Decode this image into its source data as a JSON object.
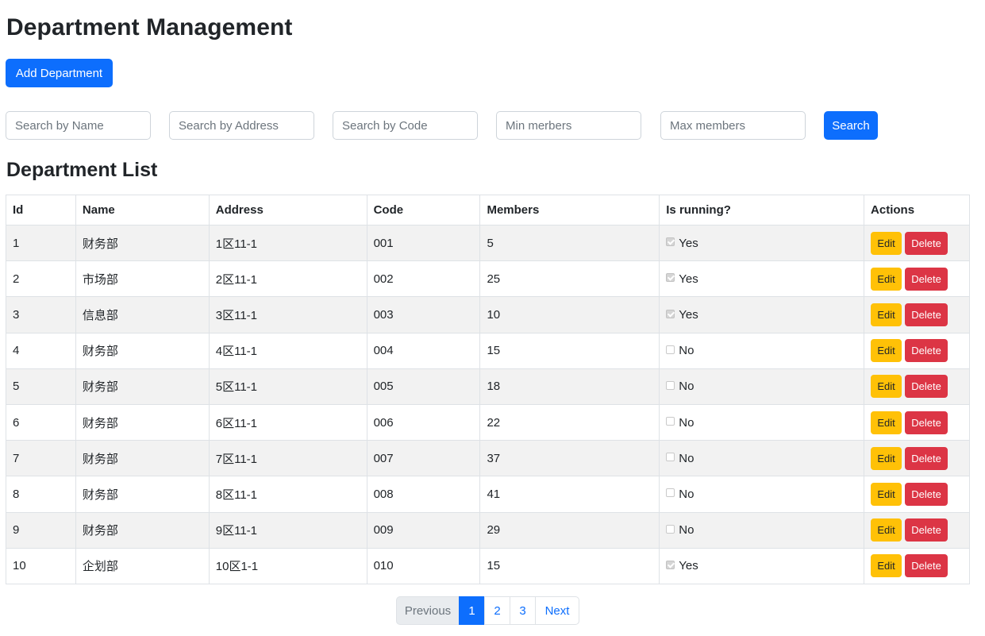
{
  "page_title": "Department Management",
  "add_button": "Add Department",
  "filters": {
    "name_placeholder": "Search by Name",
    "address_placeholder": "Search by Address",
    "code_placeholder": "Search by Code",
    "min_placeholder": "Min merbers",
    "max_placeholder": "Max members",
    "search_button": "Search"
  },
  "list_title": "Department List",
  "table": {
    "headers": [
      "Id",
      "Name",
      "Address",
      "Code",
      "Members",
      "Is running?",
      "Actions"
    ],
    "rows": [
      {
        "id": "1",
        "name": "财务部",
        "address": "1区11-1",
        "code": "001",
        "members": "5",
        "running": true,
        "running_label": "Yes"
      },
      {
        "id": "2",
        "name": "市场部",
        "address": "2区11-1",
        "code": "002",
        "members": "25",
        "running": true,
        "running_label": "Yes"
      },
      {
        "id": "3",
        "name": "信息部",
        "address": "3区11-1",
        "code": "003",
        "members": "10",
        "running": true,
        "running_label": "Yes"
      },
      {
        "id": "4",
        "name": "财务部",
        "address": "4区11-1",
        "code": "004",
        "members": "15",
        "running": false,
        "running_label": "No"
      },
      {
        "id": "5",
        "name": "财务部",
        "address": "5区11-1",
        "code": "005",
        "members": "18",
        "running": false,
        "running_label": "No"
      },
      {
        "id": "6",
        "name": "财务部",
        "address": "6区11-1",
        "code": "006",
        "members": "22",
        "running": false,
        "running_label": "No"
      },
      {
        "id": "7",
        "name": "财务部",
        "address": "7区11-1",
        "code": "007",
        "members": "37",
        "running": false,
        "running_label": "No"
      },
      {
        "id": "8",
        "name": "财务部",
        "address": "8区11-1",
        "code": "008",
        "members": "41",
        "running": false,
        "running_label": "No"
      },
      {
        "id": "9",
        "name": "财务部",
        "address": "9区11-1",
        "code": "009",
        "members": "29",
        "running": false,
        "running_label": "No"
      },
      {
        "id": "10",
        "name": "企划部",
        "address": "10区1-1",
        "code": "010",
        "members": "15",
        "running": true,
        "running_label": "Yes"
      }
    ],
    "edit_label": "Edit",
    "delete_label": "Delete"
  },
  "pagination": {
    "previous": "Previous",
    "pages": [
      "1",
      "2",
      "3"
    ],
    "active_page": "1",
    "next": "Next"
  },
  "colors": {
    "primary": "#0d6efd",
    "warning": "#ffc107",
    "danger": "#dc3545"
  }
}
